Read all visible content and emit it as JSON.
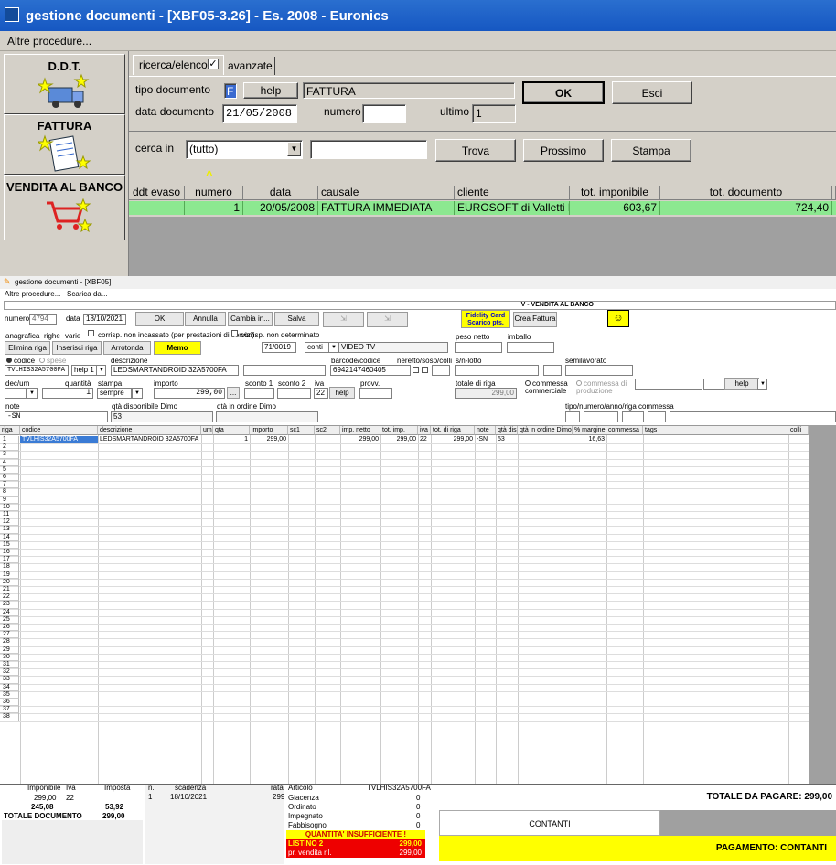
{
  "window": {
    "title": "gestione documenti - [XBF05-3.26] - Es. 2008 - Euronics"
  },
  "menu": {
    "altre": "Altre procedure..."
  },
  "nav": {
    "ddt": "D.D.T.",
    "fattura": "FATTURA",
    "vendita": "VENDITA AL BANCO"
  },
  "tabs": {
    "ricerca": "ricerca/elenco",
    "avanzate": "avanzate"
  },
  "form": {
    "tipo_label": "tipo documento",
    "tipo_value": "F",
    "help": "help",
    "tipo_desc": "FATTURA",
    "data_label": "data documento",
    "data_value": "21/05/2008",
    "numero_label": "numero",
    "numero_value": "",
    "ultimo_label": "ultimo",
    "ultimo_value": "1",
    "ok": "OK",
    "esci": "Esci",
    "cerca_label": "cerca in",
    "cerca_value": "(tutto)",
    "cerca_text": "",
    "trova": "Trova",
    "prossimo": "Prossimo",
    "stampa": "Stampa"
  },
  "grid": {
    "headers": [
      "ddt evaso",
      "numero",
      "data",
      "causale",
      "cliente",
      "tot. imponibile",
      "tot. documento"
    ],
    "row": [
      "",
      "1",
      "20/05/2008",
      "FATTURA IMMEDIATA",
      "EUROSOFT di Valletti Pie",
      "603,67",
      "724,40"
    ]
  },
  "lower": {
    "title": "gestione documenti - [XBF05]",
    "menu1": "Altre procedure...",
    "menu2": "Scarica da...",
    "banner": "V - VENDITA AL BANCO",
    "numero_label": "numero",
    "numero_value": "4794",
    "data_label": "data",
    "data_value": "18/10/2021",
    "ok": "OK",
    "annulla": "Annulla",
    "cambia": "Cambia in...",
    "salva": "Salva",
    "fidelity": "Fidelity Card\nScarico pts.",
    "crea": "Crea Fattura",
    "tab_anag": "anagrafica",
    "tab_righe": "righe",
    "tab_varie": "varie",
    "corr_nonincassato": "corrisp. non incassato (per prestazioni di servizi)",
    "corr_nondet": "corrisp. non determinato",
    "elimina": "Elimina riga",
    "inserisci": "Inserisci riga",
    "arrotonda": "Arrotonda",
    "memo": "Memo",
    "cat_code": "71/0019",
    "conti": "conti",
    "cat_desc": "VIDEO TV",
    "peso_label": "peso netto",
    "imballo_label": "imballo",
    "codice_radio": "codice",
    "spese_radio": "spese",
    "descr_label": "descrizione",
    "barcode_label": "barcode/codice",
    "nereto_label": "neretto/sosp/colli",
    "sn_label": "s/n-lotto",
    "semil_label": "semilavorato",
    "codice_value": "TVLHIS32A5700FA",
    "help1": "help 1",
    "descr_value": "LEDSMARTANDROID 32A5700FA",
    "barcode_value": "6942147460405",
    "dec_label": "dec/um",
    "qta_label": "quantità",
    "stampa_label": "stampa",
    "importo_label": "importo",
    "sconto1_label": "sconto 1",
    "sconto2_label": "sconto 2",
    "iva_label": "iva",
    "provv_label": "provv.",
    "totriga_label": "totale di riga",
    "qta_value": "1",
    "stampa_value": "sempre",
    "importo_value": "299,00",
    "iva_value": "22",
    "help": "help",
    "totriga_value": "299,00",
    "comm_comm": "commessa\ncommerciale",
    "comm_prod": "commessa di\nproduzione",
    "help2": "help",
    "note_label": "note",
    "qtadisp_label": "qtà disponibile Dimo",
    "qtaord_label": "qtà in ordine Dimo",
    "tipo_comm_label": "tipo/numero/anno/riga commessa",
    "note_value": "-SN",
    "qtadisp_value": "53",
    "col_headers": [
      "riga",
      "codice",
      "descrizione",
      "um",
      "qta",
      "importo",
      "sc1",
      "sc2",
      "imp. netto",
      "tot. imp.",
      "iva",
      "tot. di riga",
      "note",
      "qtà dis",
      "qtà in ordine Dimo",
      "% margine",
      "commessa",
      "tags",
      "colli"
    ],
    "row1": [
      "1",
      "TVLHIS32A5700FA",
      "LEDSMARTANDROID 32A5700FA",
      "",
      "1",
      "299,00",
      "",
      "",
      "299,00",
      "299,00",
      "22",
      "299,00",
      "-SN",
      "53",
      "",
      "16,63",
      "",
      "",
      ""
    ],
    "row_count": 38,
    "totals": {
      "imponibile_label": "Imponibile",
      "iva_label": "Iva",
      "imposta_label": "Imposta",
      "imp1": "299,00",
      "iva1": "22",
      "imposta1": "",
      "imp2": "245,08",
      "imposta2": "53,92",
      "totdoc_label": "TOTALE DOCUMENTO",
      "totdoc": "299,00"
    },
    "scad": {
      "n_label": "n.",
      "scad_label": "scadenza",
      "rata_label": "rata",
      "n": "1",
      "data": "18/10/2021",
      "rata": "299"
    },
    "art": {
      "art_label": "Articolo",
      "art_value": "TVLHIS32A5700FA",
      "giac_label": "Giacenza",
      "giac": "0",
      "ord_label": "Ordinato",
      "ord": "0",
      "imp_label": "Impegnato",
      "imp": "0",
      "fab_label": "Fabbisogno",
      "fab": "0",
      "warn": "QUANTITA' INSUFFICIENTE !",
      "listino_label": "LISTINO 2",
      "listino": "299,00",
      "prv_label": "pr. vendita ril.",
      "prv": "299,00"
    },
    "pay": {
      "totale": "TOTALE DA PAGARE: 299,00",
      "contanti": "CONTANTI",
      "pagamento": "PAGAMENTO: CONTANTI"
    }
  },
  "colors": {
    "title": "#1657c2",
    "row_green": "#8ce890",
    "yellow": "#ffff00",
    "red": "#ff0000"
  }
}
